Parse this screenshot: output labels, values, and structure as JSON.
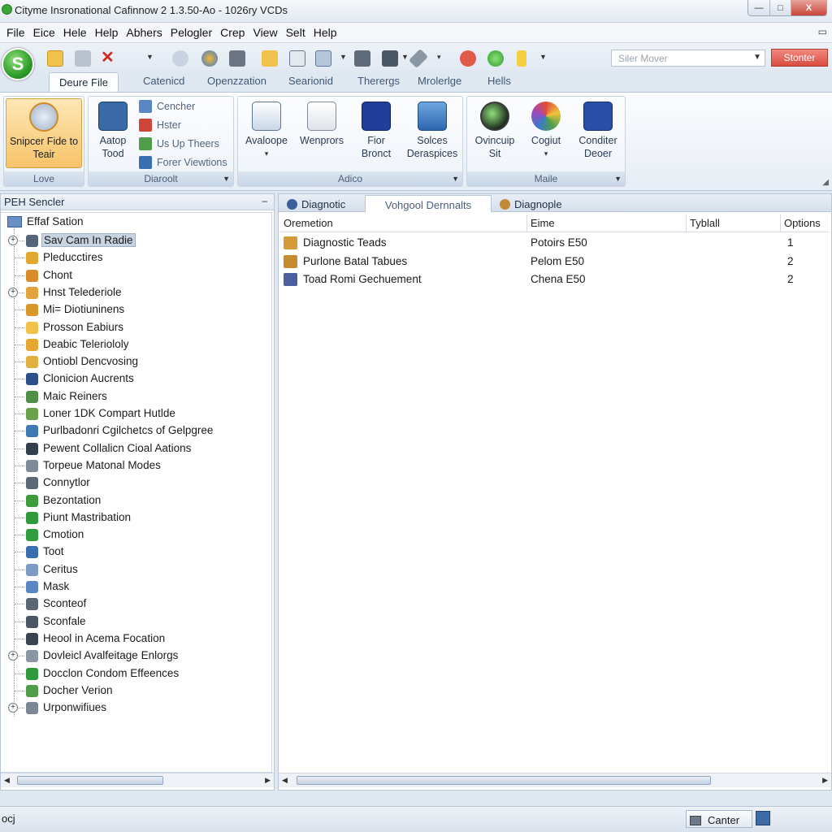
{
  "window": {
    "title": "Cityme Insronational Cafinnow 2 1.3.50-Ao - 1026ry VCDs",
    "controls": [
      "—",
      "□",
      "X"
    ]
  },
  "menu": {
    "items": [
      "File",
      "Eice",
      "Hele",
      "Help",
      "Abhers",
      "Pelogler",
      "Crep",
      "View",
      "Selt",
      "Help"
    ]
  },
  "quick_access": {
    "orb_label": "S",
    "search_placeholder": "Siler Mover",
    "action_button": "Stonter"
  },
  "ribbon": {
    "tabs": [
      "Deure File",
      "Catenicd",
      "Openzzation",
      "Searionid",
      "Therergs",
      "Mrolerlge",
      "Hells"
    ],
    "active_tab": "Deure File",
    "groups": [
      {
        "label": "Love",
        "buttons": [
          {
            "label": "Snipcer Fide to Teair",
            "icon": "gauge-icon"
          }
        ]
      },
      {
        "label": "Diaroolt",
        "buttons": [
          {
            "label": "Aatop Tood",
            "icon": "computer-icon"
          }
        ],
        "small_buttons": [
          {
            "label": "Cencher",
            "icon": "chart-icon"
          },
          {
            "label": "Hster",
            "icon": "tools-icon"
          },
          {
            "label": "Us Up Theers",
            "icon": "puzzle-icon"
          },
          {
            "label": "Forer Viewtions",
            "icon": "grid-icon"
          }
        ]
      },
      {
        "label": "Adico",
        "buttons": [
          {
            "label": "Avaloope",
            "icon": "window-icon"
          },
          {
            "label": "Wenprors",
            "icon": "document-icon"
          },
          {
            "label": "Fior Bronct",
            "icon": "circuit-icon"
          },
          {
            "label": "Solces Deraspices",
            "icon": "monitor-icon"
          }
        ]
      },
      {
        "label": "Maile",
        "buttons": [
          {
            "label": "Ovincuip Sit",
            "icon": "globe-icon"
          },
          {
            "label": "Cogiut",
            "icon": "color-wheel-icon"
          },
          {
            "label": "Conditer Deoer",
            "icon": "wrench-icon"
          }
        ]
      }
    ]
  },
  "left_panel": {
    "header": "PEH Sencler",
    "pin": "⊸",
    "root": "Effaf Sation",
    "items": [
      {
        "label": "Sav Cam In Radie",
        "icon": "camera-icon",
        "expander": true,
        "selected": true,
        "color": "#55667a"
      },
      {
        "label": "Pleducctires",
        "icon": "bulb-icon",
        "expander": false,
        "color": "#e0a82e"
      },
      {
        "label": "Chont",
        "icon": "person-icon",
        "expander": false,
        "color": "#d98a2b"
      },
      {
        "label": "Hnst Telederiole",
        "icon": "house-icon",
        "expander": true,
        "color": "#e2a23c"
      },
      {
        "label": "Mi= Diotiuninens",
        "icon": "folder-icon",
        "expander": false,
        "color": "#d9962a"
      },
      {
        "label": "Prosson Eabiurs",
        "icon": "lightbulb-icon",
        "expander": false,
        "color": "#f0c24a"
      },
      {
        "label": "Deabic Teleriololy",
        "icon": "star-icon",
        "expander": false,
        "color": "#e6a830"
      },
      {
        "label": "Ontiobl Dencvosing",
        "icon": "diamond-icon",
        "expander": false,
        "color": "#e0b040"
      },
      {
        "label": "Clonicion Aucrents",
        "icon": "book-icon",
        "expander": false,
        "color": "#2d4f8a"
      },
      {
        "label": "Maic Reiners",
        "icon": "leaf-icon",
        "expander": false,
        "color": "#4f8f4a"
      },
      {
        "label": "Loner 1DK Compart Hutlde",
        "icon": "chart-icon",
        "expander": false,
        "color": "#6aa04a"
      },
      {
        "label": "Purlbadonri Cgilchetcs of Gelpgree",
        "icon": "folder-icon",
        "expander": false,
        "color": "#3f78b5"
      },
      {
        "label": "Pewent Collalicn Cioal Aations",
        "icon": "printer-icon",
        "expander": false,
        "color": "#333f4f"
      },
      {
        "label": "Torpeue Matonal Modes",
        "icon": "clock-icon",
        "expander": false,
        "color": "#7d8a9a"
      },
      {
        "label": "Connytlor",
        "icon": "magnifier-icon",
        "expander": false,
        "color": "#5a6878"
      },
      {
        "label": "Bezontation",
        "icon": "green-square-icon",
        "expander": false,
        "color": "#3d9a3d"
      },
      {
        "label": "Piunt Mastribation",
        "icon": "green-circle-icon",
        "expander": false,
        "color": "#2e9a3a"
      },
      {
        "label": "Cmotion",
        "icon": "arrow-down-icon",
        "expander": false,
        "color": "#2f9c3f"
      },
      {
        "label": "Toot",
        "icon": "phone-icon",
        "expander": false,
        "color": "#3a6eb0"
      },
      {
        "label": "Ceritus",
        "icon": "disc-icon",
        "expander": false,
        "color": "#7d9ac4"
      },
      {
        "label": "Mask",
        "icon": "globe-icon",
        "expander": false,
        "color": "#5b86c4"
      },
      {
        "label": "Sconteof",
        "icon": "mug-icon",
        "expander": false,
        "color": "#5c6774"
      },
      {
        "label": "Sconfale",
        "icon": "device-icon",
        "expander": false,
        "color": "#4a5565"
      },
      {
        "label": "Heool in Acema Focation",
        "icon": "keyboard-icon",
        "expander": false,
        "color": "#3a4450"
      },
      {
        "label": "Dovleicl Avalfeitage Enlorgs",
        "icon": "gear-icon",
        "expander": true,
        "color": "#8b96a4"
      },
      {
        "label": "Docclon Condom Effeences",
        "icon": "shield-icon",
        "expander": false,
        "color": "#2f9a3c"
      },
      {
        "label": "Docher Verion",
        "icon": "tile-icon",
        "expander": false,
        "color": "#4f9c4a"
      },
      {
        "label": "Urponwifiues",
        "icon": "settings-icon",
        "expander": true,
        "color": "#7b8796"
      }
    ]
  },
  "right_panel": {
    "tabs": [
      {
        "label": "Diagnotic",
        "icon": "circle-icon",
        "color": "#3b5f9b"
      },
      {
        "label": "Vohgool Dernnalts",
        "icon": "none",
        "color": ""
      },
      {
        "label": "Diagnople",
        "icon": "circle-icon",
        "color": "#c28a36"
      }
    ],
    "active_tab": "Vohgool Dernnalts",
    "columns": [
      "Oremetion",
      "Eime",
      "Tyblall",
      "Options"
    ],
    "rows": [
      {
        "name": "Diagnostic Teads",
        "time": "Potoirs E50",
        "type": "",
        "options": "1",
        "icon": "folder-icon",
        "color": "#d79a36"
      },
      {
        "name": "Purlone Batal Tabues",
        "time": "Pelom E50",
        "type": "",
        "options": "2",
        "icon": "image-icon",
        "color": "#c88a2e"
      },
      {
        "name": "Toad Romi Gechuement",
        "time": "Chena E50",
        "type": "",
        "options": "2",
        "icon": "table-icon",
        "color": "#4a5ea0"
      }
    ]
  },
  "status": {
    "left_text": "ocj",
    "center_button": "Canter"
  }
}
